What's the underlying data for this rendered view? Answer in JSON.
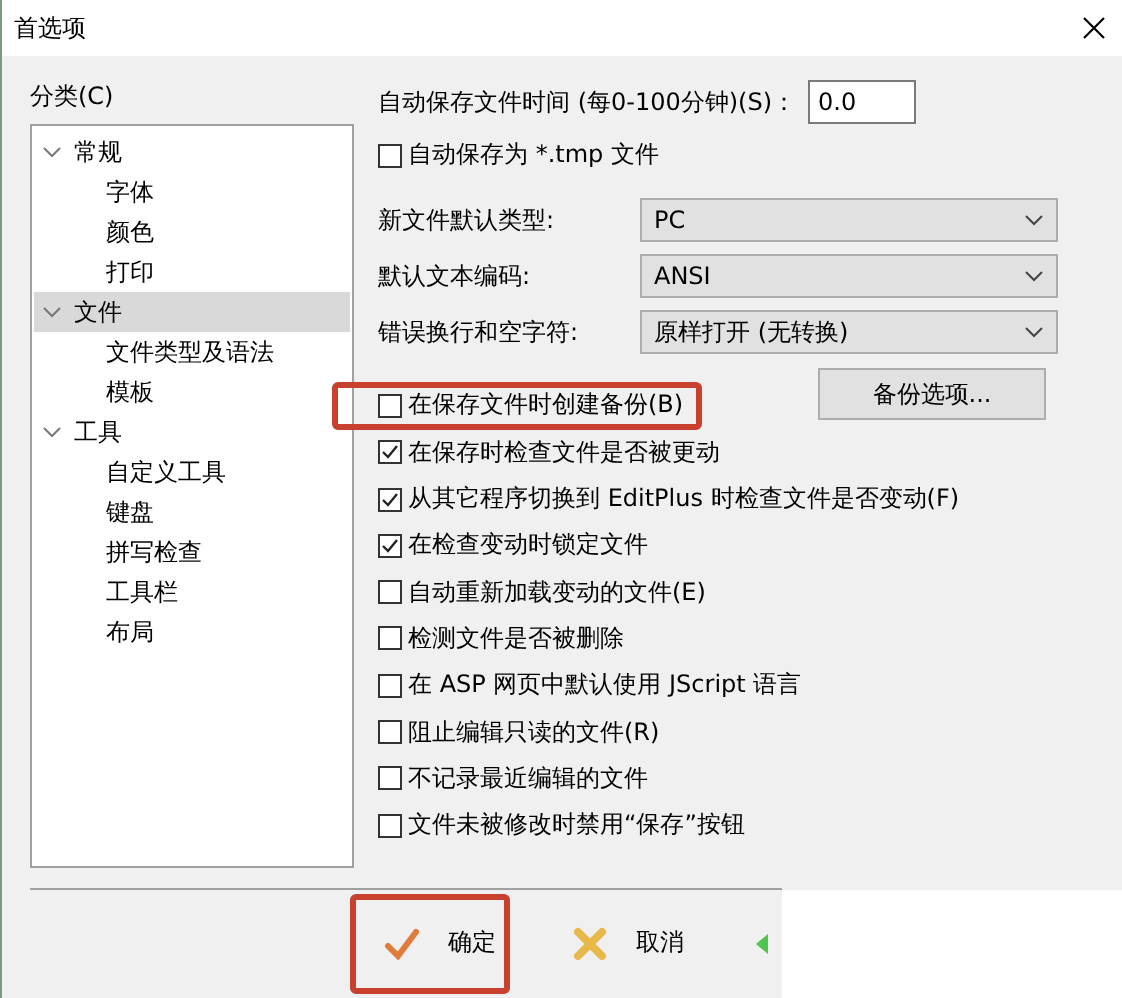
{
  "window": {
    "title": "首选项"
  },
  "category_label": "分类(C)",
  "tree": [
    {
      "label": "常规",
      "expanded": true,
      "selected": false,
      "children": [
        {
          "label": "字体",
          "selected": false
        },
        {
          "label": "颜色",
          "selected": false
        },
        {
          "label": "打印",
          "selected": false
        }
      ]
    },
    {
      "label": "文件",
      "expanded": true,
      "selected": true,
      "children": [
        {
          "label": "文件类型及语法",
          "selected": false
        },
        {
          "label": "模板",
          "selected": false
        }
      ]
    },
    {
      "label": "工具",
      "expanded": true,
      "selected": false,
      "children": [
        {
          "label": "自定义工具",
          "selected": false
        },
        {
          "label": "键盘",
          "selected": false
        },
        {
          "label": "拼写检查",
          "selected": false
        },
        {
          "label": "工具栏",
          "selected": false
        },
        {
          "label": "布局",
          "selected": false
        }
      ]
    }
  ],
  "autosave": {
    "label": "自动保存文件时间 (每0-100分钟)(S)：",
    "value": "0.0"
  },
  "tmp_checkbox": {
    "label": "自动保存为 *.tmp 文件",
    "checked": false
  },
  "selects": [
    {
      "label": "新文件默认类型:",
      "value": "PC"
    },
    {
      "label": "默认文本编码:",
      "value": "ANSI"
    },
    {
      "label": "错误换行和空字符:",
      "value": "原样打开 (无转换)"
    }
  ],
  "backup_button": "备份选项...",
  "checkboxes": [
    {
      "label": "在保存文件时创建备份(B)",
      "checked": false,
      "highlighted": true
    },
    {
      "label": "在保存时检查文件是否被更动",
      "checked": true,
      "highlighted": false
    },
    {
      "label": "从其它程序切换到 EditPlus 时检查文件是否变动(F)",
      "checked": true,
      "highlighted": false
    },
    {
      "label": "在检查变动时锁定文件",
      "checked": true,
      "highlighted": false
    },
    {
      "label": "自动重新加载变动的文件(E)",
      "checked": false,
      "highlighted": false
    },
    {
      "label": "检测文件是否被删除",
      "checked": false,
      "highlighted": false
    },
    {
      "label": "在 ASP 网页中默认使用 JScript 语言",
      "checked": false,
      "highlighted": false
    },
    {
      "label": "阻止编辑只读的文件(R)",
      "checked": false,
      "highlighted": false
    },
    {
      "label": "不记录最近编辑的文件",
      "checked": false,
      "highlighted": false
    },
    {
      "label": "文件未被修改时禁用“保存”按钮",
      "checked": false,
      "highlighted": false
    }
  ],
  "buttons": [
    {
      "kind": "ok",
      "label": "确定",
      "highlighted": true
    },
    {
      "kind": "cancel",
      "label": "取消",
      "highlighted": false
    },
    {
      "kind": "apply",
      "highlighted": false
    }
  ]
}
